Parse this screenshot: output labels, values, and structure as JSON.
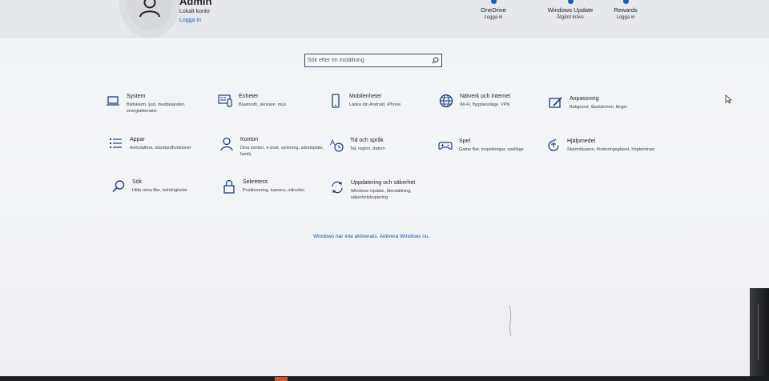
{
  "account": {
    "name": "Admin",
    "type": "Lokalt konto",
    "login": "Logga in"
  },
  "header_items": [
    {
      "title": "OneDrive",
      "sub": "Logga in"
    },
    {
      "title": "Windows Update",
      "sub": "Åtgärd krävs"
    },
    {
      "title": "Rewards",
      "sub": "Logga in"
    }
  ],
  "search": {
    "placeholder": "Sök efter en inställning"
  },
  "tiles": [
    {
      "title": "System",
      "desc": "Bildskärm, ljud, meddelanden, energialternativ",
      "icon": "laptop-icon"
    },
    {
      "title": "Enheter",
      "desc": "Bluetooth, skrivare, mus",
      "icon": "devices-icon"
    },
    {
      "title": "Mobilenheter",
      "desc": "Länka din Android, iPhone",
      "icon": "phone-icon"
    },
    {
      "title": "Nätverk och Internet",
      "desc": "Wi-Fi, flygplansläge, VPN",
      "icon": "globe-icon"
    },
    {
      "title": "Anpassning",
      "desc": "Bakgrund, låsskärmen, färger",
      "icon": "personalization-icon"
    },
    {
      "title": "Appar",
      "desc": "Avinstallera, standardfunktioner",
      "icon": "apps-list-icon"
    },
    {
      "title": "Konton",
      "desc": "Dina konton, e-post, synkning, arbetsplats, familj",
      "icon": "person-icon"
    },
    {
      "title": "Tid och språk",
      "desc": "Tal, region, datum",
      "icon": "time-language-icon"
    },
    {
      "title": "Spel",
      "desc": "Game Bar, inspelningar, spelläge",
      "icon": "gamepad-icon"
    },
    {
      "title": "Hjälpmedel",
      "desc": "Skärmläsaren, förstoringsglaset, högkontrast",
      "icon": "accessibility-icon"
    },
    {
      "title": "Sök",
      "desc": "Hitta mina filer, behörigheter",
      "icon": "search-icon"
    },
    {
      "title": "Sekretess",
      "desc": "Positionering, kamera, mikrofon",
      "icon": "lock-icon"
    },
    {
      "title": "Uppdatering och säkerhet",
      "desc": "Windows Update, återställning, säkerhetskopiering",
      "icon": "sync-icon"
    }
  ],
  "activation_link": "Windows har inte aktiverats. Aktivera Windows nu.",
  "colors": {
    "accent": "#1a55a8",
    "icon": "#1f3f7a",
    "text": "#1d1f22"
  }
}
